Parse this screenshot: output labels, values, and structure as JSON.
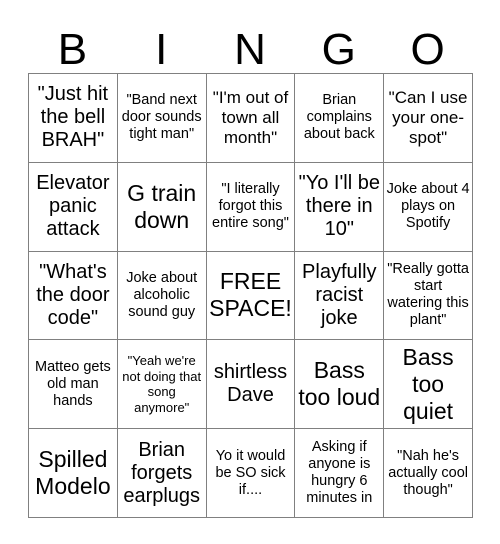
{
  "card": {
    "title_letters": [
      "B",
      "I",
      "N",
      "G",
      "O"
    ],
    "rows": [
      [
        {
          "text": "\"Just hit the bell BRAH\"",
          "size": "fs-lg"
        },
        {
          "text": "\"Band next door sounds tight man\"",
          "size": "fs-sm"
        },
        {
          "text": "\"I'm out of town all month\"",
          "size": "fs-md"
        },
        {
          "text": "Brian complains about back",
          "size": "fs-sm"
        },
        {
          "text": "\"Can I use your one-spot\"",
          "size": "fs-md"
        }
      ],
      [
        {
          "text": "Elevator panic attack",
          "size": "fs-lg"
        },
        {
          "text": "G train down",
          "size": "fs-xl"
        },
        {
          "text": "\"I literally forgot this entire song\"",
          "size": "fs-sm"
        },
        {
          "text": "\"Yo I'll be there in 10\"",
          "size": "fs-lg"
        },
        {
          "text": "Joke about 4 plays on Spotify",
          "size": "fs-sm"
        }
      ],
      [
        {
          "text": "\"What's the door code\"",
          "size": "fs-lg"
        },
        {
          "text": "Joke about alcoholic sound guy",
          "size": "fs-sm"
        },
        {
          "text": "FREE SPACE!",
          "size": "fs-xl"
        },
        {
          "text": "Playfully racist joke",
          "size": "fs-lg"
        },
        {
          "text": "\"Really gotta start watering this plant\"",
          "size": "fs-sm"
        }
      ],
      [
        {
          "text": "Matteo gets old man hands",
          "size": "fs-sm"
        },
        {
          "text": "\"Yeah we're not doing that song anymore\"",
          "size": "fs-xs"
        },
        {
          "text": "shirtless Dave",
          "size": "fs-lg"
        },
        {
          "text": "Bass too loud",
          "size": "fs-xl"
        },
        {
          "text": "Bass too quiet",
          "size": "fs-xl"
        }
      ],
      [
        {
          "text": "Spilled Modelo",
          "size": "fs-xl"
        },
        {
          "text": "Brian forgets earplugs",
          "size": "fs-lg"
        },
        {
          "text": "Yo it would be SO sick if....",
          "size": "fs-sm"
        },
        {
          "text": "Asking if anyone is hungry 6 minutes in",
          "size": "fs-sm"
        },
        {
          "text": "\"Nah he's actually cool though\"",
          "size": "fs-sm"
        }
      ]
    ]
  }
}
